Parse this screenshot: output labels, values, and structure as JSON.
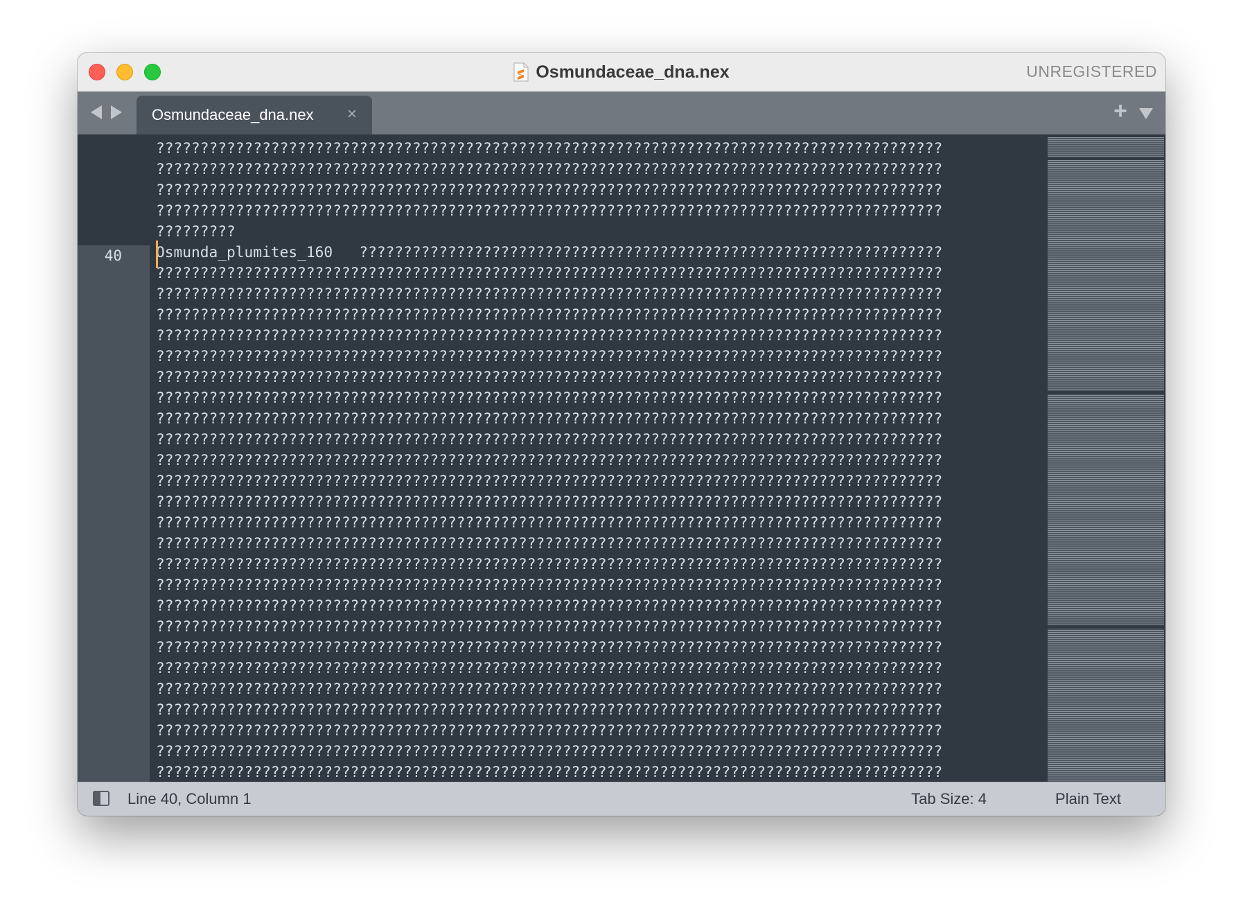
{
  "window": {
    "title": "Osmundaceae_dna.nex",
    "registration_status": "UNREGISTERED"
  },
  "tabbar": {
    "active_tab": "Osmundaceae_dna.nex",
    "close_glyph": "×",
    "add_glyph": "+"
  },
  "editor": {
    "current_line_number": "40",
    "lines": [
      "?????????????????????????????????????????????????????????????????????????????????????????",
      "?????????????????????????????????????????????????????????????????????????????????????????",
      "?????????????????????????????????????????????????????????????????????????????????????????",
      "?????????????????????????????????????????????????????????????????????????????????????????",
      "?????????",
      "Osmunda_plumites_160   ??????????????????????????????????????????????????????????????????",
      "?????????????????????????????????????????????????????????????????????????????????????????",
      "?????????????????????????????????????????????????????????????????????????????????????????",
      "?????????????????????????????????????????????????????????????????????????????????????????",
      "?????????????????????????????????????????????????????????????????????????????????????????",
      "?????????????????????????????????????????????????????????????????????????????????????????",
      "?????????????????????????????????????????????????????????????????????????????????????????",
      "?????????????????????????????????????????????????????????????????????????????????????????",
      "?????????????????????????????????????????????????????????????????????????????????????????",
      "?????????????????????????????????????????????????????????????????????????????????????????",
      "?????????????????????????????????????????????????????????????????????????????????????????",
      "?????????????????????????????????????????????????????????????????????????????????????????",
      "?????????????????????????????????????????????????????????????????????????????????????????",
      "?????????????????????????????????????????????????????????????????????????????????????????",
      "?????????????????????????????????????????????????????????????????????????????????????????",
      "?????????????????????????????????????????????????????????????????????????????????????????",
      "?????????????????????????????????????????????????????????????????????????????????????????",
      "?????????????????????????????????????????????????????????????????????????????????????????",
      "?????????????????????????????????????????????????????????????????????????????????????????",
      "?????????????????????????????????????????????????????????????????????????????????????????",
      "?????????????????????????????????????????????????????????????????????????????????????????",
      "?????????????????????????????????????????????????????????????????????????????????????????",
      "?????????????????????????????????????????????????????????????????????????????????????????",
      "?????????????????????????????????????????????????????????????????????????????????????????",
      "?????????????????????????????????????????????????????????????????????????????????????????",
      "?????????????????????????????????????????????????????????????????????????????????????????"
    ]
  },
  "statusbar": {
    "position": "Line 40, Column 1",
    "tab_size": "Tab Size: 4",
    "syntax": "Plain Text"
  },
  "colors": {
    "editor_bg": "#303841",
    "gutter_current_line": "#4a525c",
    "caret": "#f9ae58",
    "text": "#d8dee9",
    "tabbar_bg": "#727880",
    "statusbar_bg": "#c8ccd2"
  },
  "icons": {
    "file": "sublime-file-icon",
    "nav_back": "triangle-left-icon",
    "nav_forward": "triangle-right-icon",
    "tab_close": "close-icon",
    "new_tab": "plus-icon",
    "tab_menu": "chevron-down-icon",
    "panel_toggle": "sidebar-toggle-icon"
  }
}
